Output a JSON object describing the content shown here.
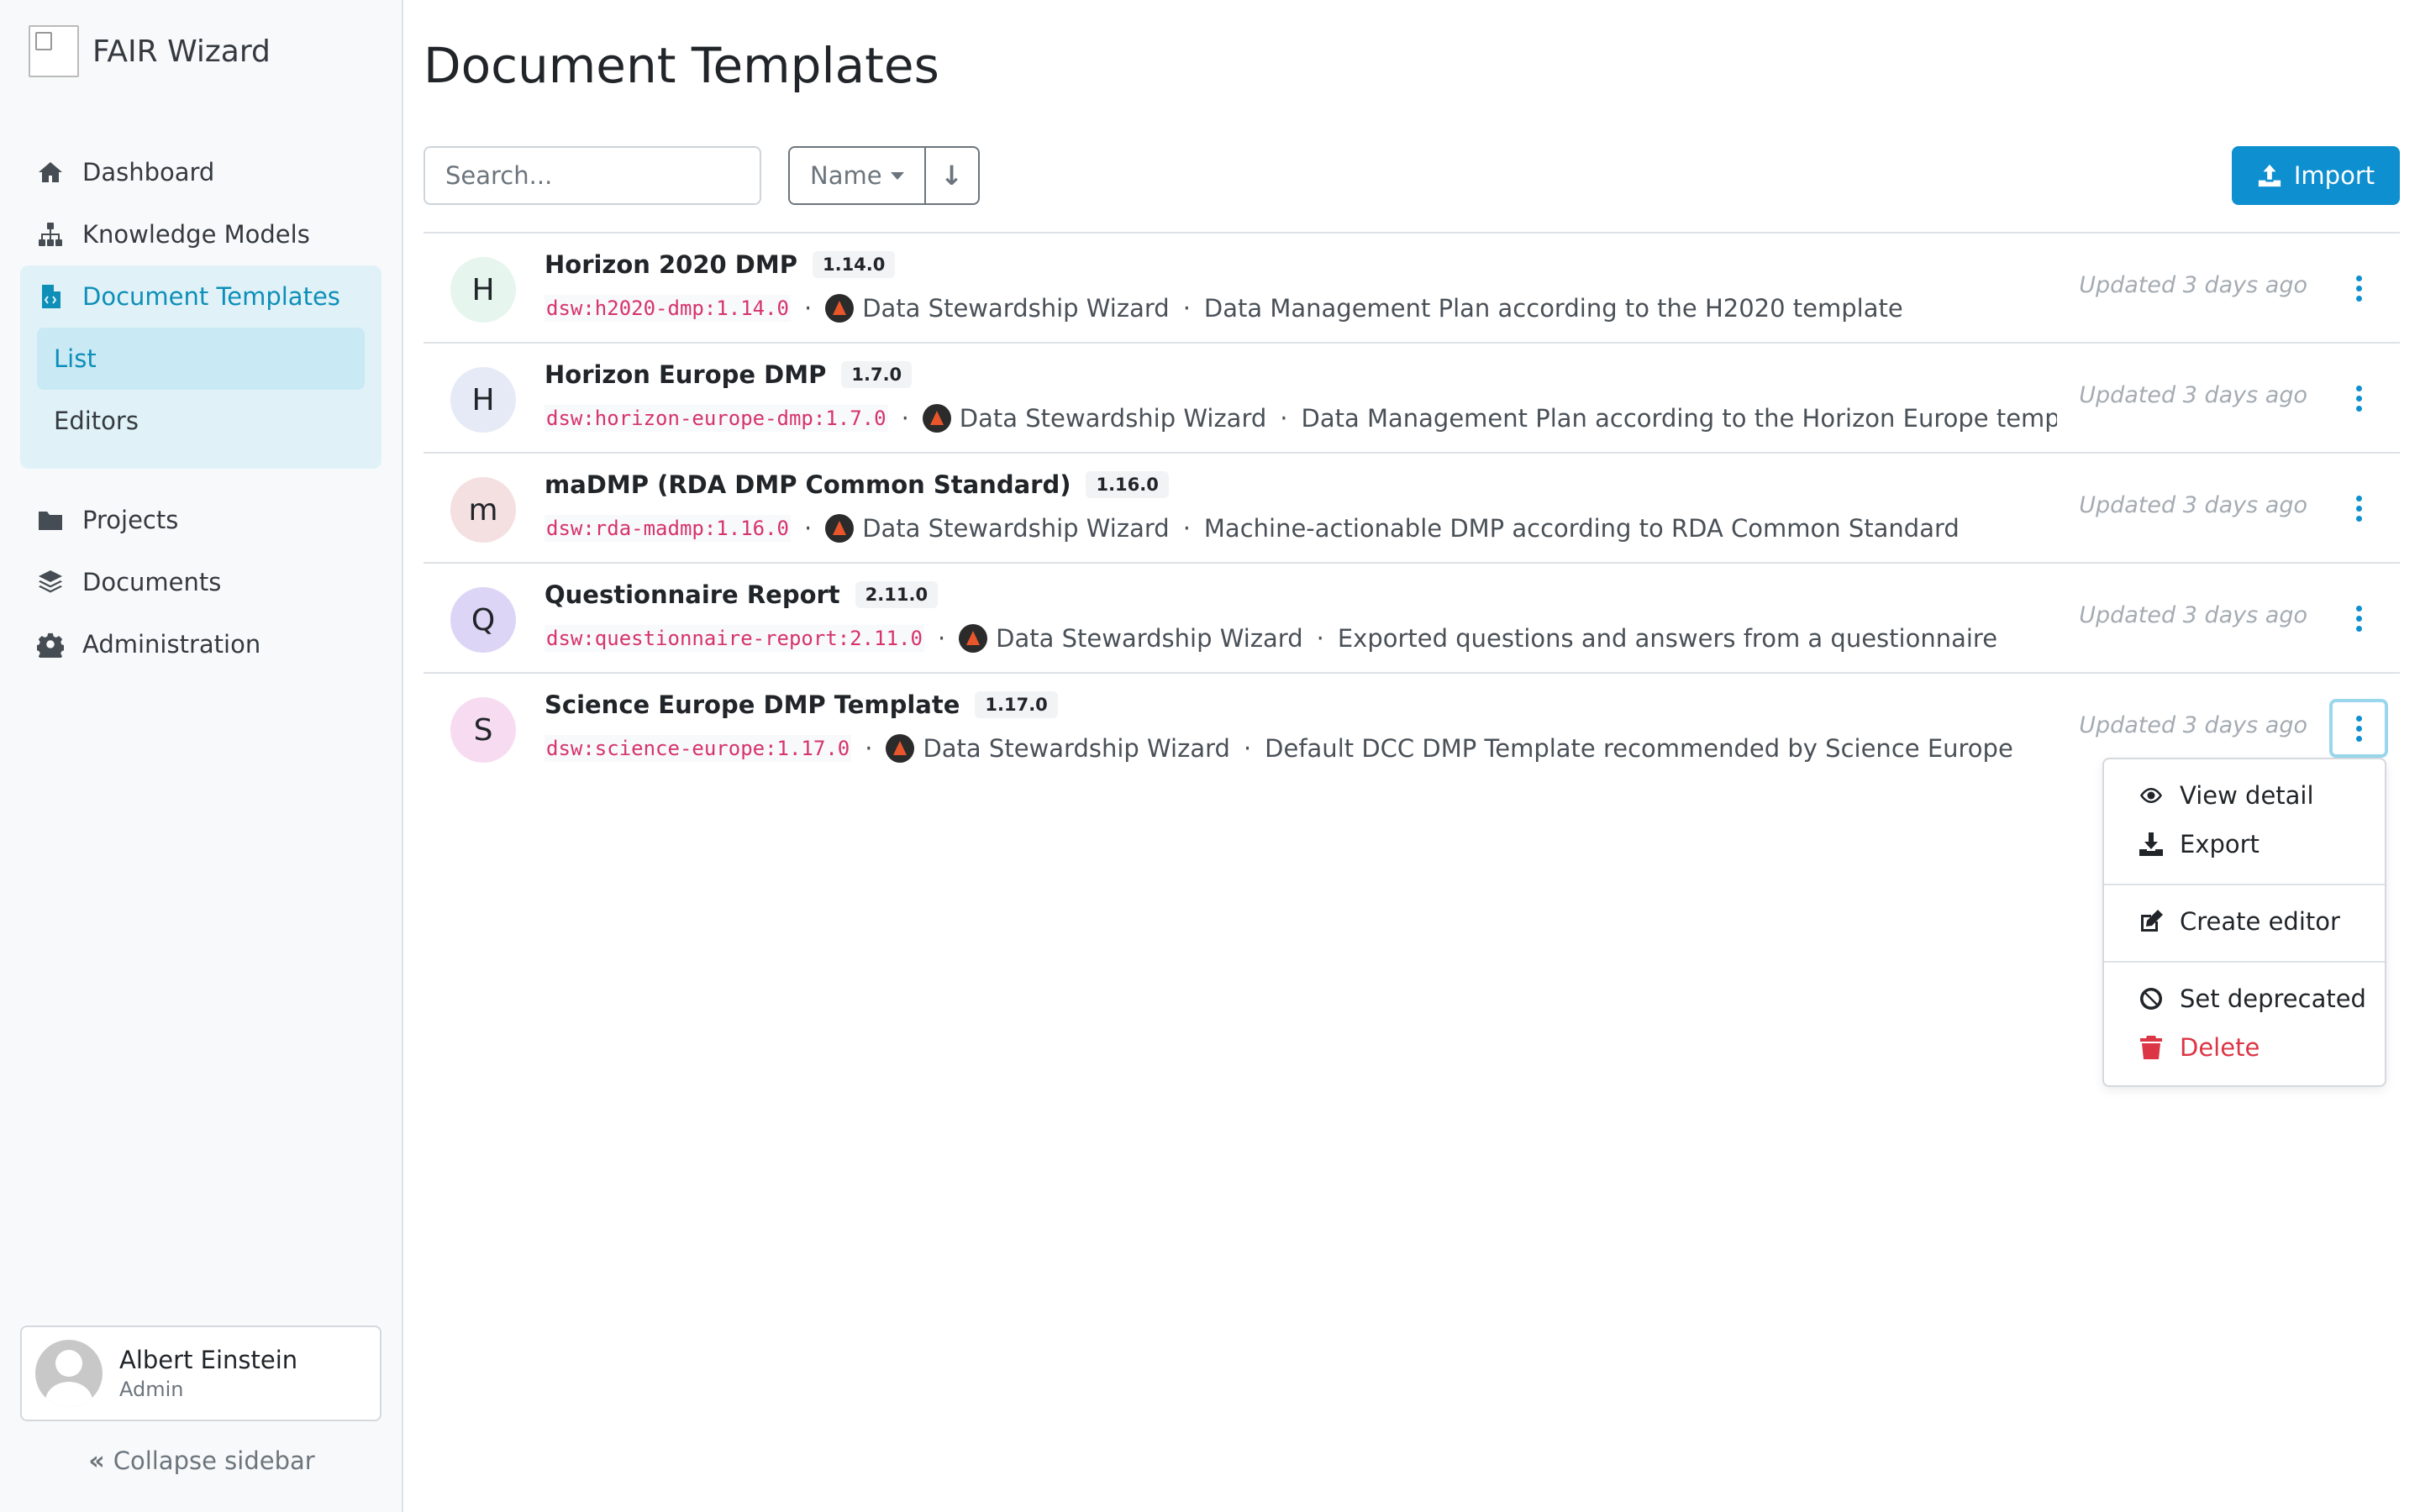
{
  "app": {
    "name": "FAIR Wizard"
  },
  "sidebar": {
    "items": [
      {
        "label": "Dashboard",
        "icon": "home-icon"
      },
      {
        "label": "Knowledge Models",
        "icon": "sitemap-icon"
      },
      {
        "label": "Document Templates",
        "icon": "file-code-icon",
        "active": true
      },
      {
        "label": "Projects",
        "icon": "folder-icon"
      },
      {
        "label": "Documents",
        "icon": "layers-icon"
      },
      {
        "label": "Administration",
        "icon": "gear-icon"
      }
    ],
    "subitems": [
      {
        "label": "List",
        "active": true
      },
      {
        "label": "Editors"
      }
    ],
    "user": {
      "name": "Albert Einstein",
      "role": "Admin"
    },
    "collapse_label": "Collapse sidebar"
  },
  "main": {
    "title": "Document Templates",
    "search_placeholder": "Search...",
    "sort_label": "Name",
    "sort_direction_icon": "↓",
    "import_label": "Import",
    "accent_color": "#0d8fd0"
  },
  "templates": [
    {
      "initial": "H",
      "avatar_color": "#e6f6ef",
      "name": "Horizon 2020 DMP",
      "version": "1.14.0",
      "id": "dsw:h2020-dmp:1.14.0",
      "org": "Data Stewardship Wizard",
      "description": "Data Management Plan according to the H2020 template",
      "updated": "Updated 3 days ago"
    },
    {
      "initial": "H",
      "avatar_color": "#e6eaf7",
      "name": "Horizon Europe DMP",
      "version": "1.7.0",
      "id": "dsw:horizon-europe-dmp:1.7.0",
      "org": "Data Stewardship Wizard",
      "description": "Data Management Plan according to the Horizon Europe templat",
      "updated": "Updated 3 days ago"
    },
    {
      "initial": "m",
      "avatar_color": "#f4dfe1",
      "name": "maDMP (RDA DMP Common Standard)",
      "version": "1.16.0",
      "id": "dsw:rda-madmp:1.16.0",
      "org": "Data Stewardship Wizard",
      "description": "Machine-actionable DMP according to RDA Common Standard",
      "updated": "Updated 3 days ago"
    },
    {
      "initial": "Q",
      "avatar_color": "#ddd5f6",
      "name": "Questionnaire Report",
      "version": "2.11.0",
      "id": "dsw:questionnaire-report:2.11.0",
      "org": "Data Stewardship Wizard",
      "description": "Exported questions and answers from a questionnaire",
      "updated": "Updated 3 days ago"
    },
    {
      "initial": "S",
      "avatar_color": "#f7dbf1",
      "name": "Science Europe DMP Template",
      "version": "1.17.0",
      "id": "dsw:science-europe:1.17.0",
      "org": "Data Stewardship Wizard",
      "description": "Default DCC DMP Template recommended by Science Europe",
      "updated": "Updated 3 days ago"
    }
  ],
  "dropdown": {
    "items": [
      {
        "label": "View detail",
        "icon": "eye-icon"
      },
      {
        "label": "Export",
        "icon": "download-icon"
      },
      {
        "label": "Create editor",
        "icon": "edit-icon"
      },
      {
        "label": "Set deprecated",
        "icon": "ban-icon"
      },
      {
        "label": "Delete",
        "icon": "trash-icon",
        "danger_color": "#dc3545"
      }
    ]
  }
}
